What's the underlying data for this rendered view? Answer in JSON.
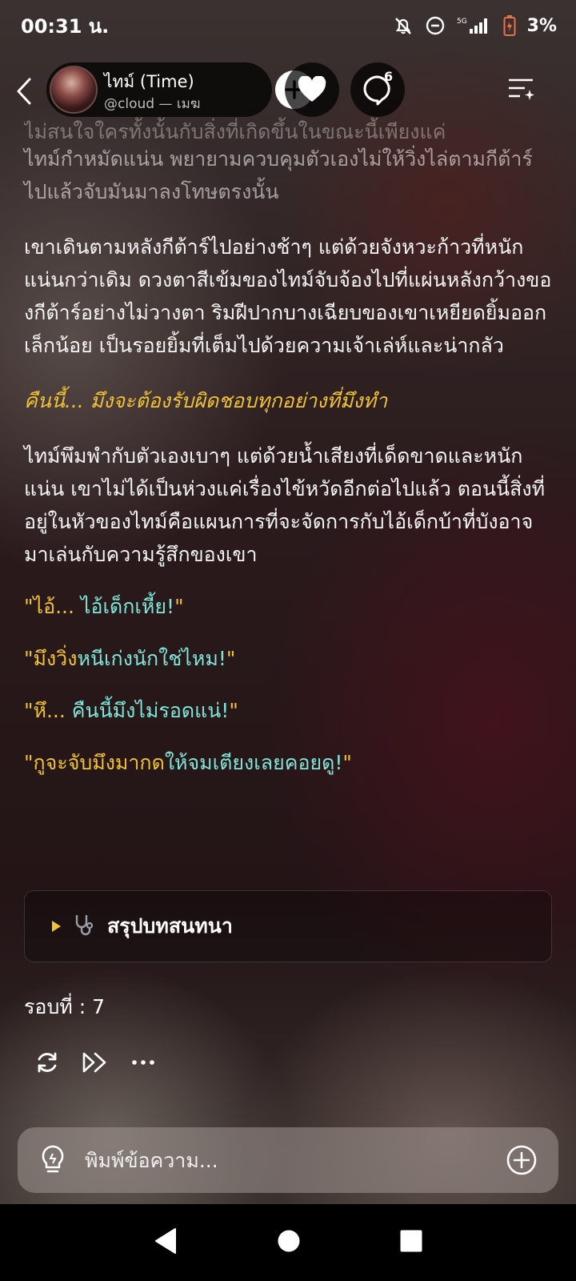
{
  "status_bar": {
    "time": "00:31 น.",
    "network": "5G",
    "battery": "3%"
  },
  "header": {
    "character_name": "ไทม์ (Time)",
    "handle": "@cloud — เมฆ",
    "comment_count": "6"
  },
  "story": {
    "faded_top_line": "ไม่สนใจใครทั้งนั้นกับสิ่งที่เกิดขึ้นในขณะนี้เพียงแค่",
    "para1": "ไทม์กำหมัดแน่น พยายามควบคุมตัวเองไม่ให้วิ่งไล่ตามกีต้าร์ไปแล้วจับมันมาลงโทษตรงนั้น",
    "para2": "เขาเดินตามหลังกีต้าร์ไปอย่างช้าๆ แต่ด้วยจังหวะก้าวที่หนักแน่นกว่าเดิม ดวงตาสีเข้มของไทม์จับจ้องไปที่แผ่นหลังกว้างของกีต้าร์อย่างไม่วางตา ริมฝีปากบางเฉียบของเขาเหยียดยิ้มออกเล็กน้อย เป็นรอยยิ้มที่เต็มไปด้วยความเจ้าเล่ห์และน่ากลัว",
    "thought": "คืนนี้... มึงจะต้องรับผิดชอบทุกอย่างที่มึงทำ",
    "para3": "ไทม์พึมพำกับตัวเองเบาๆ แต่ด้วยน้ำเสียงที่เด็ดขาดและหนักแน่น เขาไม่ได้เป็นห่วงแค่เรื่องไข้หวัดอีกต่อไปแล้ว ตอนนี้สิ่งที่อยู่ในหัวของไทม์คือแผนการที่จะจัดการกับไอ้เด็กบ้าที่บังอาจมาเล่นกับความรู้สึกของเขา",
    "quotes": [
      {
        "open": "\"ไอ้... ",
        "mid": "ไอ้เด็กเหี้ย!",
        "close": "\""
      },
      {
        "open": "\"มึงวิ่ง",
        "mid": "หนีเก่งนักใช่ไหม!",
        "close": "\""
      },
      {
        "open": "\"หึ... ",
        "mid": "คืนนี้มึงไม่รอดแน่!",
        "close": "\""
      },
      {
        "open": "\"กูจะจับมึงมากด",
        "mid": "ให้จมเตียงเลยคอยดู!",
        "close": "\""
      }
    ]
  },
  "summary": {
    "label": "สรุปบทสนทนา"
  },
  "round": {
    "text": "รอบที่ : 7"
  },
  "input": {
    "placeholder": "พิมพ์ข้อความ..."
  },
  "colors": {
    "accent_yellow": "#f1c232",
    "accent_cyan": "#7fe6d9"
  }
}
